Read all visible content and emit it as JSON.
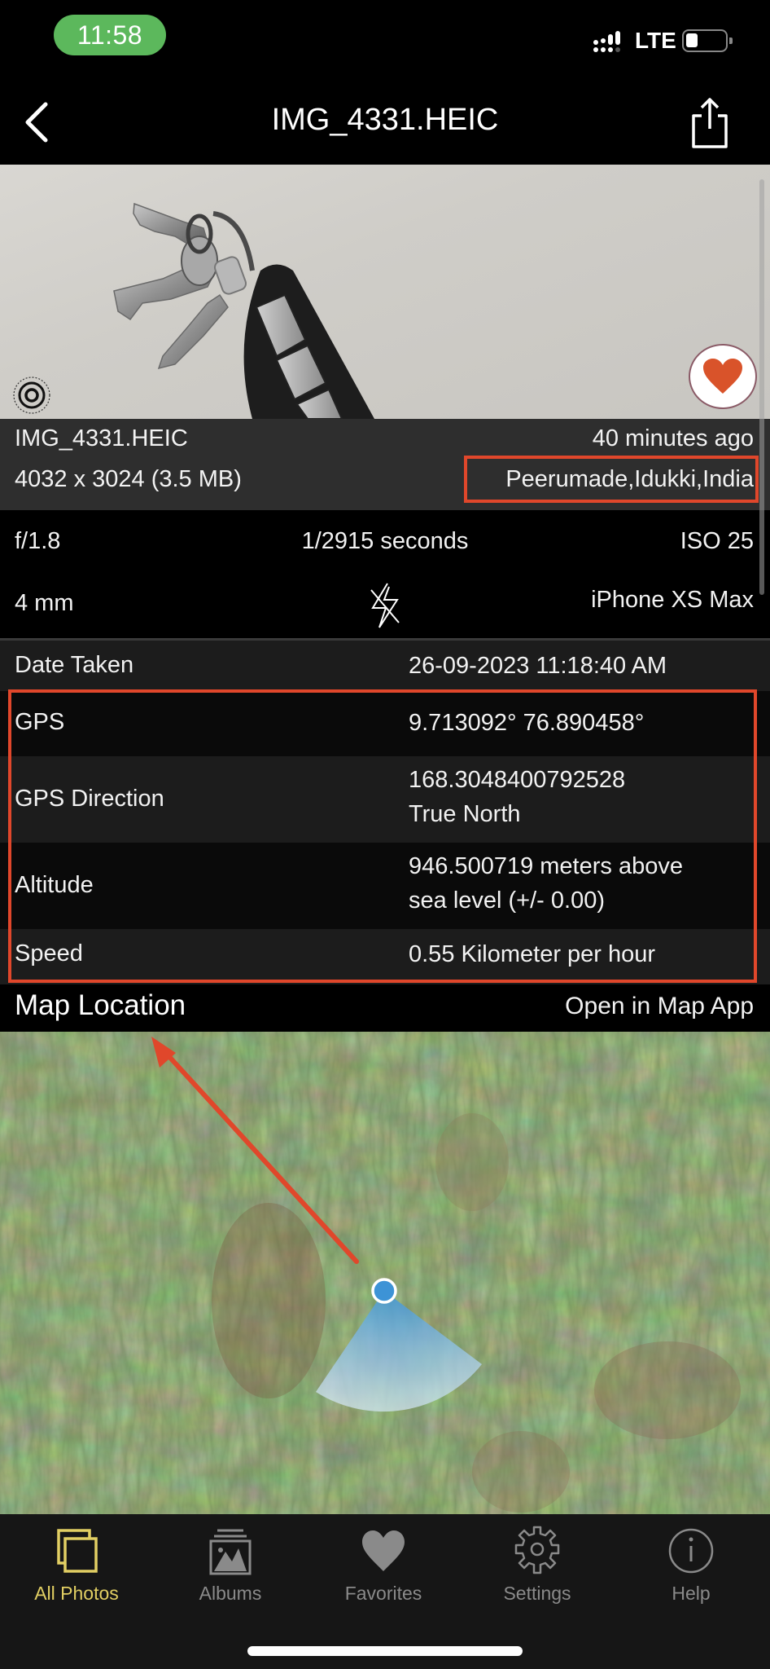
{
  "status_bar": {
    "time": "11:58",
    "network": "LTE",
    "battery_level": 0.25,
    "signal_bars": 3,
    "time_pill_color": "#5cb85c"
  },
  "nav": {
    "title": "IMG_4331.HEIC",
    "back_icon": "chevron-left-icon",
    "share_icon": "share-icon"
  },
  "photo": {
    "description": "Keys on a ring with a car key fob on a white surface",
    "live_icon": "live-photo-icon",
    "favorite_icon": "heart-icon",
    "favorited": true,
    "favorite_color": "#d9532a"
  },
  "photo_info": {
    "filename": "IMG_4331.HEIC",
    "relative_time": "40 minutes ago",
    "dimensions": "4032 x 3024 (3.5 MB)",
    "location": "Peerumade,Idukki,India"
  },
  "exif": {
    "aperture": "f/1.8",
    "shutter": "1/2915 seconds",
    "iso": "ISO 25",
    "focal_length": "4 mm",
    "flash_icon": "flash-off-icon",
    "camera": "iPhone XS Max"
  },
  "details": [
    {
      "label": "Date Taken",
      "value": [
        "26-09-2023 11:18:40 AM"
      ]
    },
    {
      "label": "GPS",
      "value": [
        "9.713092° 76.890458°"
      ]
    },
    {
      "label": "GPS Direction",
      "value": [
        "168.3048400792528",
        "True North"
      ]
    },
    {
      "label": "Altitude",
      "value": [
        "946.500719 meters above",
        "sea level (+/- 0.00)"
      ]
    },
    {
      "label": "Speed",
      "value": [
        "0.55 Kilometer per hour"
      ]
    }
  ],
  "map": {
    "title": "Map Location",
    "open_link": "Open in Map App",
    "heading_degrees": 168.3,
    "annotation_color": "#e0472b",
    "pin_color": "#3d93d6"
  },
  "tabs": [
    {
      "label": "All Photos",
      "icon": "photos-stack-icon",
      "active": true
    },
    {
      "label": "Albums",
      "icon": "albums-icon",
      "active": false
    },
    {
      "label": "Favorites",
      "icon": "heart-icon",
      "active": false
    },
    {
      "label": "Settings",
      "icon": "gear-icon",
      "active": false
    },
    {
      "label": "Help",
      "icon": "info-icon",
      "active": false
    }
  ],
  "accent_color": "#e2cf63"
}
